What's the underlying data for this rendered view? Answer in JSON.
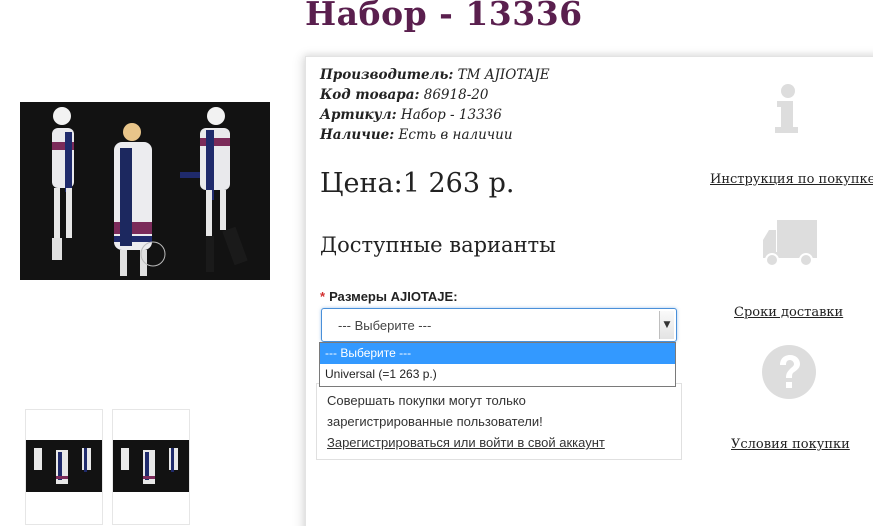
{
  "product": {
    "title": "Набор - 13336",
    "info": [
      {
        "label": "Производитель:",
        "value": "ТМ AJIOTAJE"
      },
      {
        "label": "Код товара:",
        "value": "86918-20"
      },
      {
        "label": "Артикул:",
        "value": "Набор - 13336"
      },
      {
        "label": "Наличие:",
        "value": "Есть в наличии"
      }
    ],
    "price": "Цена:1 263 р.",
    "variants_title": "Доступные варианты",
    "size": {
      "required_mark": "*",
      "label": "Размеры AJIOTAJE:",
      "selected": "--- Выберите ---",
      "options": [
        "--- Выберите ---",
        "Universal (=1 263 р.)"
      ]
    },
    "login_notice": {
      "text_line1": "Совершать покупки могут только",
      "text_line2": "зарегистрированные пользователи!",
      "link": "Зарегистрироваться или войти в свой аккаунт"
    }
  },
  "side_links": {
    "instructions": "Инструкция по покупке",
    "delivery": "Сроки доставки",
    "conditions": "Условия покупки"
  },
  "icons": {
    "info": "info-icon",
    "delivery": "truck-icon",
    "conditions": "question-icon"
  },
  "colors": {
    "title": "#5a1f4e",
    "select_focus": "#4a90d9",
    "option_selected": "#3399ff",
    "icon_gray": "#dddddd"
  }
}
